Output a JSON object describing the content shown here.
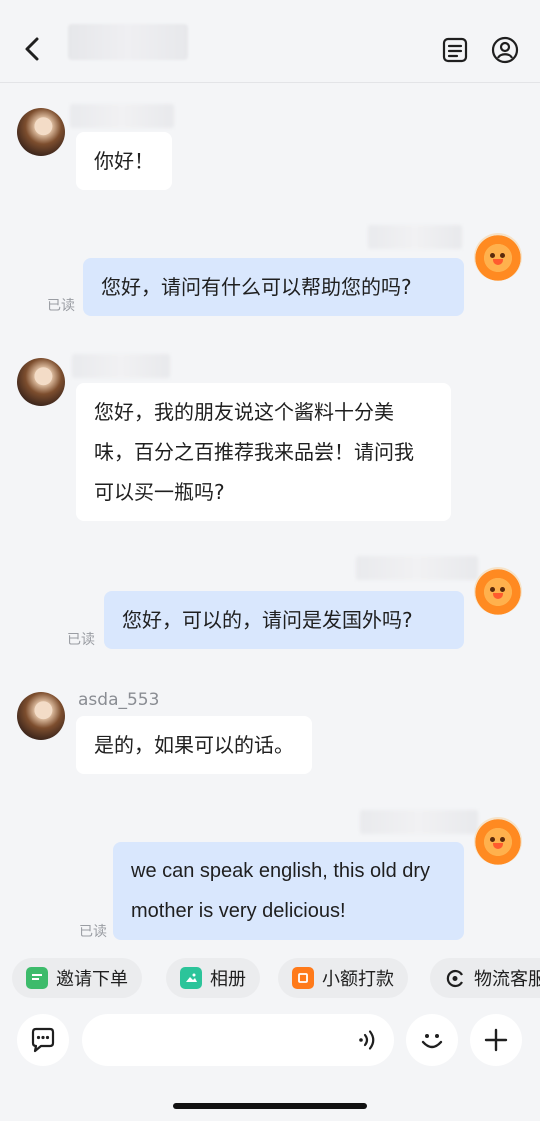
{
  "header": {
    "back_icon": "chevron-left-icon",
    "notes_icon": "notes-icon",
    "profile_icon": "user-circle-icon"
  },
  "messages": [
    {
      "direction": "in",
      "sender": "",
      "text": "你好！",
      "read": ""
    },
    {
      "direction": "out",
      "sender": "",
      "text": "您好，请问有什么可以帮助您的吗?",
      "read": "已读"
    },
    {
      "direction": "in",
      "sender": "",
      "text": "您好，我的朋友说这个酱料十分美味，百分之百推荐我来品尝！请问我可以买一瓶吗?",
      "read": ""
    },
    {
      "direction": "out",
      "sender": "",
      "text": "您好，可以的，请问是发国外吗?",
      "read": "已读"
    },
    {
      "direction": "in",
      "sender": "asda_553",
      "text": "是的，如果可以的话。",
      "read": ""
    },
    {
      "direction": "out",
      "sender": "",
      "text": "we can speak english, this old dry mother is very delicious!",
      "read": "已读"
    }
  ],
  "quick_actions": [
    {
      "label": "邀请下单",
      "icon": "invite-order-icon",
      "color": "#3dbb6b"
    },
    {
      "label": "相册",
      "icon": "photo-album-icon",
      "color": "#2cc49a"
    },
    {
      "label": "小额打款",
      "icon": "small-payment-icon",
      "color": "#ff7a1a"
    },
    {
      "label": "物流客服",
      "icon": "logistics-service-icon",
      "color": "#1f1f1f"
    }
  ],
  "input": {
    "placeholder": "",
    "value": "",
    "chat_icon": "chat-bubble-icon",
    "voice_icon": "voice-wave-icon",
    "emoji_icon": "smile-icon",
    "plus_icon": "plus-icon"
  }
}
